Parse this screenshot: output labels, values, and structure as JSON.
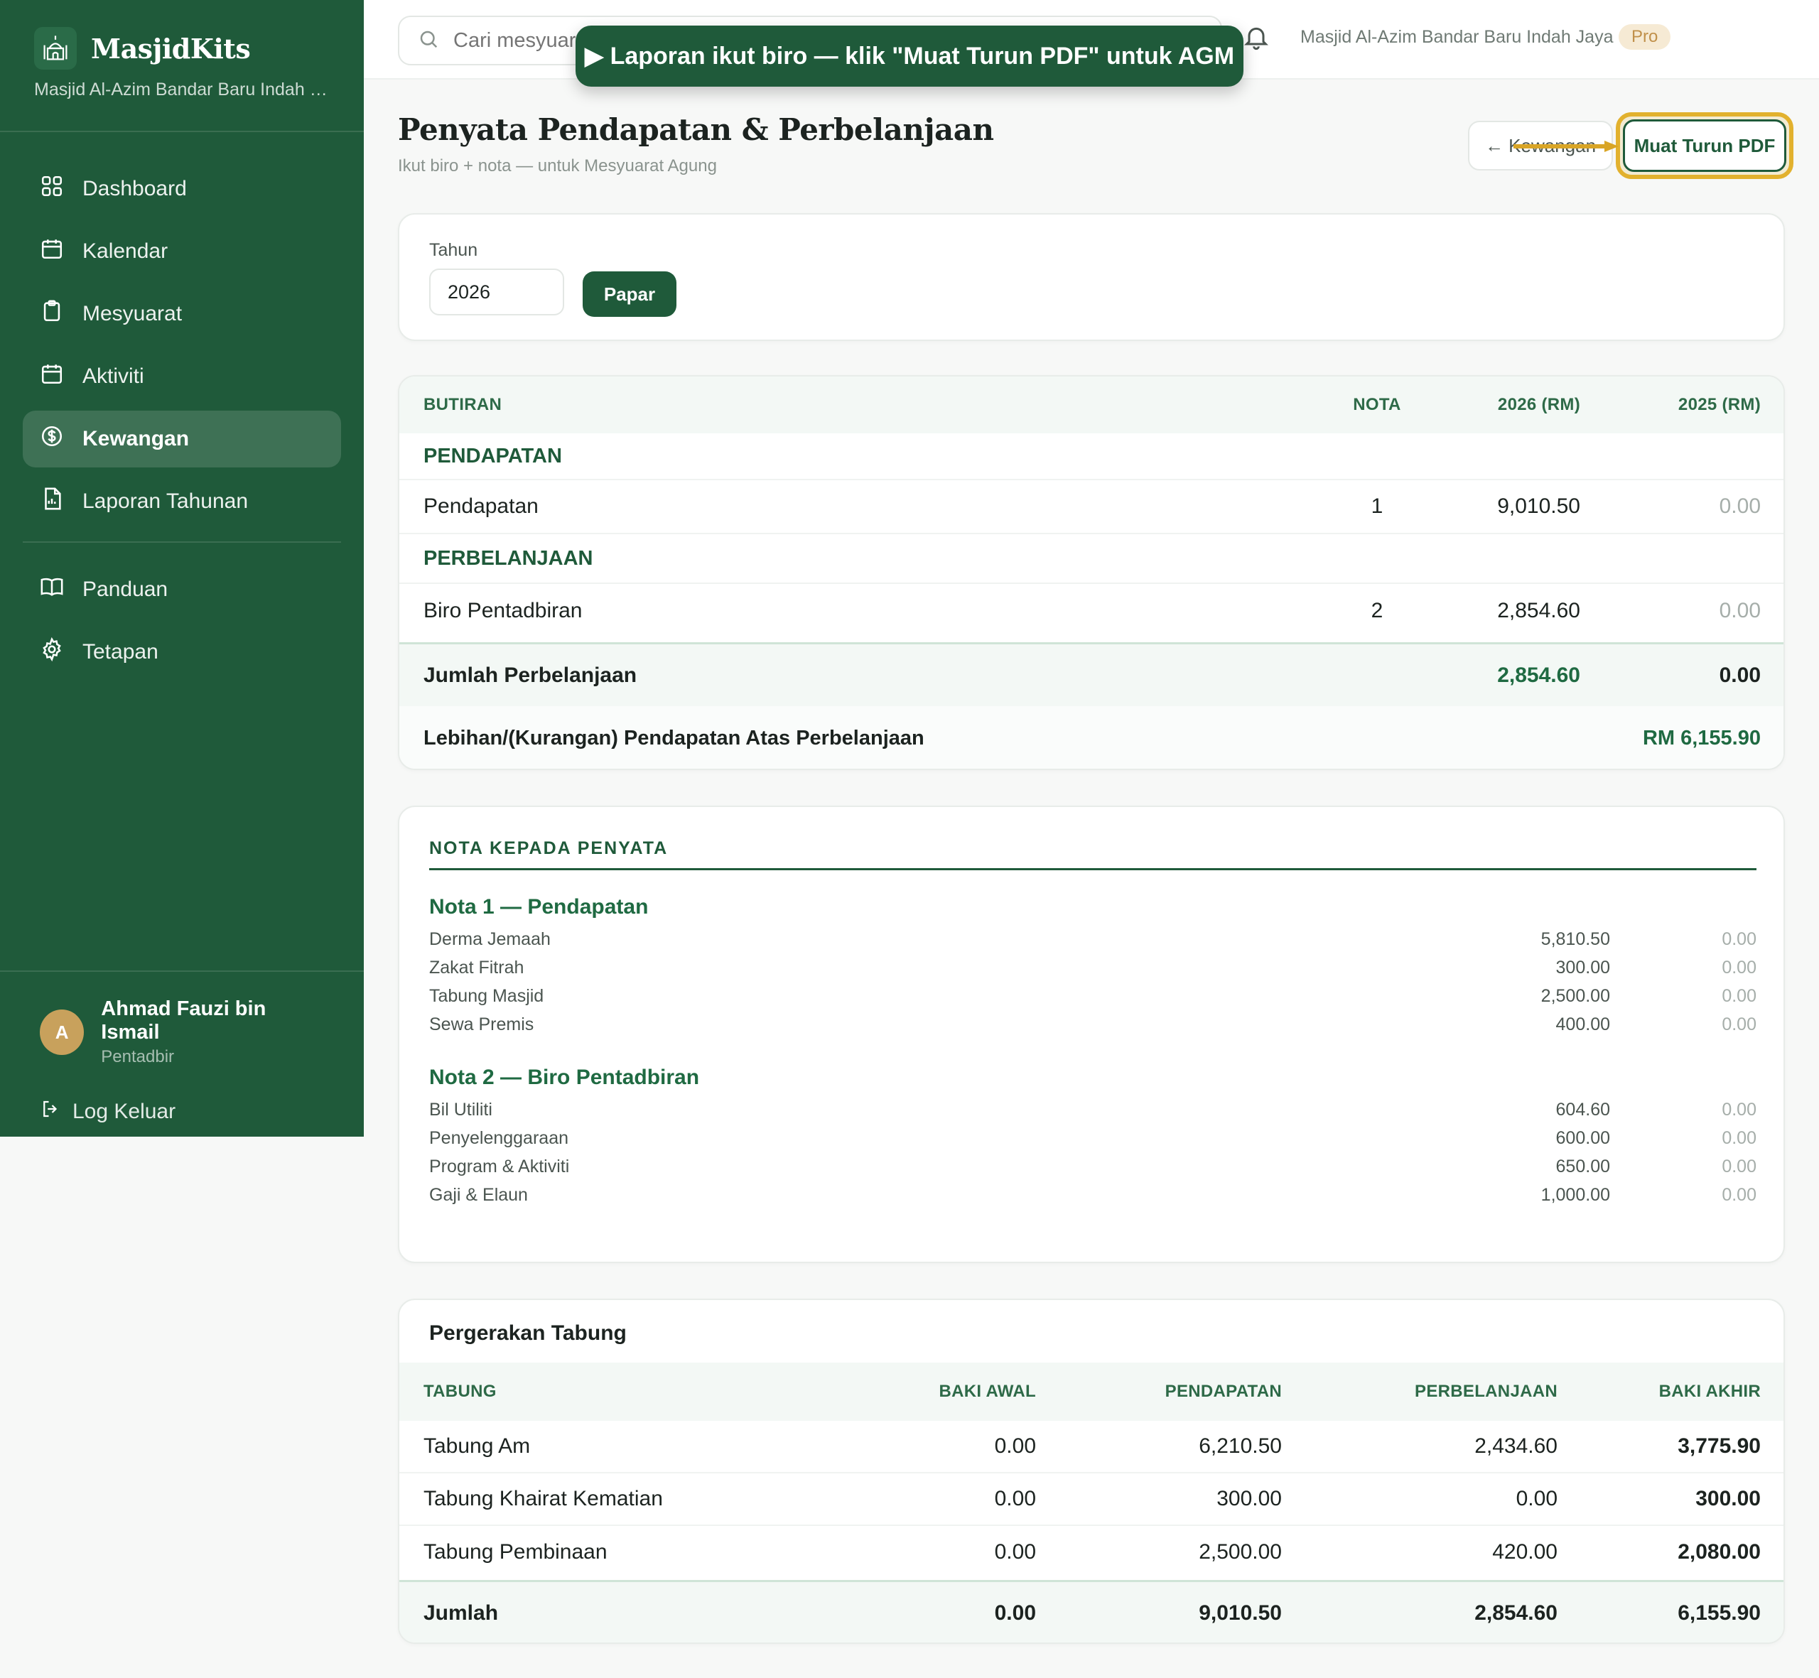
{
  "app": {
    "name": "MasjidKits",
    "mosque_short": "Masjid Al-Azim Bandar Baru Indah J...",
    "mosque_full": "Masjid Al-Azim Bandar Baru Indah Jaya",
    "plan_badge": "Pro"
  },
  "sidebar": {
    "items": [
      {
        "label": "Dashboard",
        "icon": "grid-icon"
      },
      {
        "label": "Kalendar",
        "icon": "calendar-icon"
      },
      {
        "label": "Mesyuarat",
        "icon": "clipboard-icon"
      },
      {
        "label": "Aktiviti",
        "icon": "calendar-icon"
      },
      {
        "label": "Kewangan",
        "icon": "dollar-circle-icon",
        "active": true
      },
      {
        "label": "Laporan Tahunan",
        "icon": "report-icon"
      },
      {
        "label": "Panduan",
        "icon": "book-icon"
      },
      {
        "label": "Tetapan",
        "icon": "gear-icon"
      }
    ]
  },
  "user": {
    "initial": "A",
    "name": "Ahmad Fauzi bin Ismail",
    "role": "Pentadbir",
    "logout_label": "Log Keluar"
  },
  "topbar": {
    "search_placeholder": "Cari mesyuarat"
  },
  "toast": {
    "text": "▶ Laporan ikut biro — klik \"Muat Turun PDF\" untuk AGM"
  },
  "header": {
    "title": "Penyata Pendapatan & Perbelanjaan",
    "subtitle": "Ikut biro + nota — untuk Mesyuarat Agung",
    "back_label": "← Kewangan",
    "pdf_label": "Muat Turun PDF"
  },
  "filter": {
    "label": "Tahun",
    "year": "2026",
    "button": "Papar"
  },
  "statement": {
    "columns": [
      "BUTIRAN",
      "NOTA",
      "2026 (RM)",
      "2025 (RM)"
    ],
    "section_income": "PENDAPATAN",
    "income_row": {
      "label": "Pendapatan",
      "note": "1",
      "current": "9,010.50",
      "prior": "0.00"
    },
    "section_expense": "PERBELANJAAN",
    "expense_row": {
      "label": "Biro Pentadbiran",
      "note": "2",
      "current": "2,854.60",
      "prior": "0.00"
    },
    "total_expense": {
      "label": "Jumlah Perbelanjaan",
      "current": "2,854.60",
      "prior": "0.00"
    },
    "surplus": {
      "label": "Lebihan/(Kurangan) Pendapatan Atas Perbelanjaan",
      "value": "RM 6,155.90"
    }
  },
  "notes": {
    "heading": "NOTA KEPADA PENYATA",
    "note1": {
      "title": "Nota 1 — Pendapatan",
      "lines": [
        {
          "label": "Derma Jemaah",
          "current": "5,810.50",
          "prior": "0.00"
        },
        {
          "label": "Zakat Fitrah",
          "current": "300.00",
          "prior": "0.00"
        },
        {
          "label": "Tabung Masjid",
          "current": "2,500.00",
          "prior": "0.00"
        },
        {
          "label": "Sewa Premis",
          "current": "400.00",
          "prior": "0.00"
        }
      ]
    },
    "note2": {
      "title": "Nota 2 — Biro Pentadbiran",
      "lines": [
        {
          "label": "Bil Utiliti",
          "current": "604.60",
          "prior": "0.00"
        },
        {
          "label": "Penyelenggaraan",
          "current": "600.00",
          "prior": "0.00"
        },
        {
          "label": "Program & Aktiviti",
          "current": "650.00",
          "prior": "0.00"
        },
        {
          "label": "Gaji & Elaun",
          "current": "1,000.00",
          "prior": "0.00"
        }
      ]
    }
  },
  "funds": {
    "title": "Pergerakan Tabung",
    "columns": [
      "TABUNG",
      "BAKI AWAL",
      "PENDAPATAN",
      "PERBELANJAAN",
      "BAKI AKHIR"
    ],
    "rows": [
      [
        "Tabung Am",
        "0.00",
        "6,210.50",
        "2,434.60",
        "3,775.90"
      ],
      [
        "Tabung Khairat Kematian",
        "0.00",
        "300.00",
        "0.00",
        "300.00"
      ],
      [
        "Tabung Pembinaan",
        "0.00",
        "2,500.00",
        "420.00",
        "2,080.00"
      ]
    ],
    "total": [
      "Jumlah",
      "0.00",
      "9,010.50",
      "2,854.60",
      "6,155.90"
    ]
  },
  "colors": {
    "brand_green": "#1f5a3a",
    "highlight_gold": "#e2b12e",
    "badge_bg": "#f6ead4"
  }
}
